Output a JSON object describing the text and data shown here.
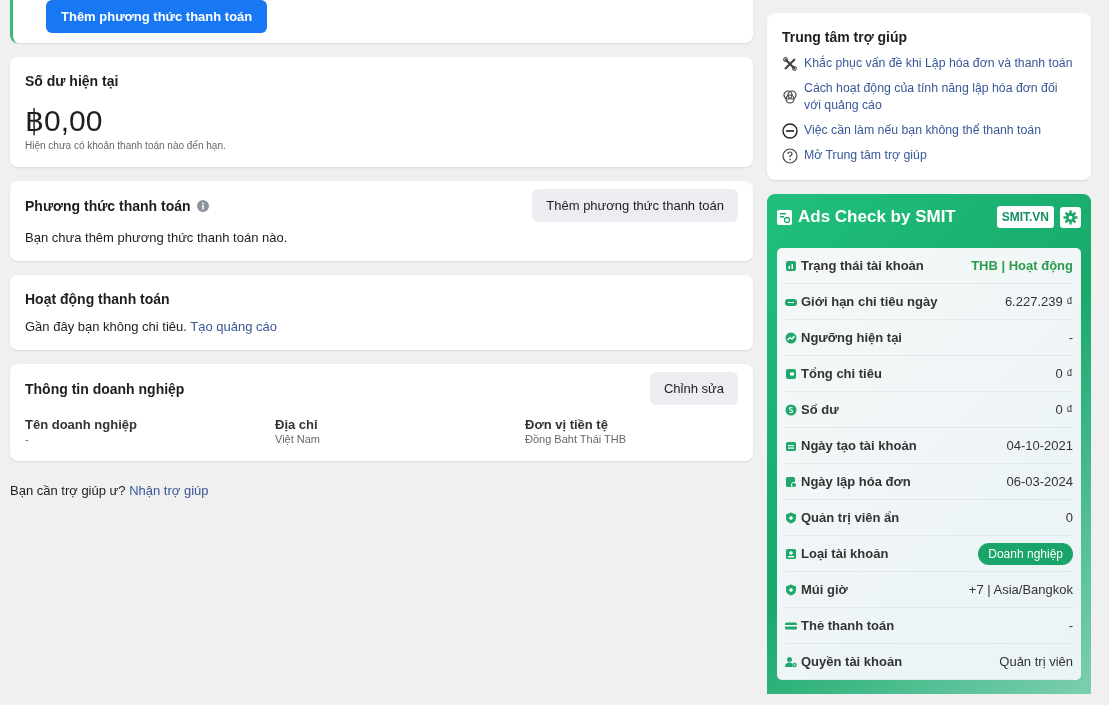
{
  "top_card": {
    "button": "Thêm phương thức thanh toán"
  },
  "balance": {
    "title": "Số dư hiện tại",
    "amount": "฿0,00",
    "note": "Hiện chưa có khoản thanh toán nào đến hạn."
  },
  "payment_methods": {
    "title": "Phương thức thanh toán",
    "button": "Thêm phương thức thanh toán",
    "text": "Bạn chưa thêm phương thức thanh toán nào."
  },
  "activity": {
    "title": "Hoạt động thanh toán",
    "text": "Gần đây bạn không chi tiêu.",
    "link": "Tạo quảng cáo"
  },
  "business": {
    "title": "Thông tin doanh nghiệp",
    "button": "Chỉnh sửa",
    "fields": [
      {
        "label": "Tên doanh nghiệp",
        "value": "-"
      },
      {
        "label": "Địa chỉ",
        "value": "Việt Nam"
      },
      {
        "label": "Đơn vị tiền tệ",
        "value": "Đồng Baht Thái THB"
      }
    ]
  },
  "help_prompt": {
    "text": "Bạn cần trợ giúp ư?",
    "link": "Nhận trợ giúp"
  },
  "help_center": {
    "title": "Trung tâm trợ giúp",
    "links": [
      {
        "text": "Khắc phục vấn đề khi Lập hóa đơn và thanh toán"
      },
      {
        "text": "Cách hoạt động của tính năng lập hóa đơn đối với quảng cáo"
      },
      {
        "text": "Việc cần làm nếu bạn không thể thanh toán"
      },
      {
        "text": "Mở Trung tâm trợ giúp"
      }
    ]
  },
  "ads_check": {
    "title": "Ads Check by SMIT",
    "site_button": "SMIT.VN",
    "rows": [
      {
        "label": "Trạng thái tài khoản",
        "value": "THB | Hoạt động",
        "kind": "status"
      },
      {
        "label": "Giới hạn chi tiêu ngày",
        "value": "6.227.239 ₫",
        "kind": "text"
      },
      {
        "label": "Ngưỡng hiện tại",
        "value": "-",
        "kind": "text"
      },
      {
        "label": "Tổng chi tiêu",
        "value": "0 ₫",
        "kind": "text"
      },
      {
        "label": "Số dư",
        "value": "0 ₫",
        "kind": "text"
      },
      {
        "label": "Ngày tạo tài khoản",
        "value": "04-10-2021",
        "kind": "text"
      },
      {
        "label": "Ngày lập hóa đơn",
        "value": "06-03-2024",
        "kind": "text"
      },
      {
        "label": "Quản trị viên ẩn",
        "value": "0",
        "kind": "text"
      },
      {
        "label": "Loại tài khoản",
        "value": "Doanh nghiệp",
        "kind": "badge"
      },
      {
        "label": "Múi giờ",
        "value": "+7 | Asia/Bangkok",
        "kind": "text"
      },
      {
        "label": "Thẻ thanh toán",
        "value": "-",
        "kind": "text"
      },
      {
        "label": "Quyền tài khoản",
        "value": "Quản trị viên",
        "kind": "text"
      }
    ]
  }
}
